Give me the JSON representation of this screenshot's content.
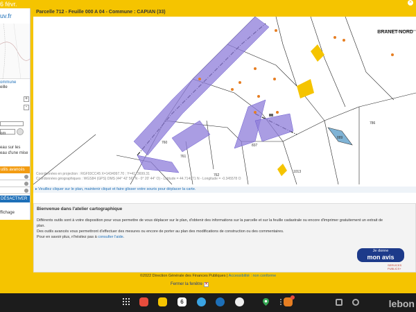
{
  "status_bar": {
    "date": "6 févr."
  },
  "sidebar": {
    "logo": "uv.fr",
    "commune_line1": "ommune",
    "commune_line2": "eille",
    "zoom_in": "+",
    "zoom_out": "-",
    "label_om": "om",
    "text_line1": "eau sur les",
    "text_line2": "eau d'une mise",
    "advanced_tools": "utils avancés",
    "deactivate": "DÉSACTIVER",
    "print": "ffichage"
  },
  "map_header": {
    "title": "Parcelle 712 - Feuille 000 A 04 - Commune : CAPIAN (33)"
  },
  "map": {
    "place_label": "BRANET-NORD",
    "parcel_labels": [
      "760",
      "761",
      "762",
      "837",
      "786",
      "1013",
      "889"
    ],
    "coords": {
      "projection_label": "Coordonnées en projection :",
      "projection_system": "RGF93CC45",
      "projection_value": "X=1434997.70 ; Y=4173699.31",
      "geo_label": "Coordonnées géographiques :",
      "geo_system": "WGS84 (GPS)",
      "geo_value": "DMS (44° 42' 56\" N - 0° 20' 44\" O) - Latitude = 44.714071 N - Longitude = -0.345578 O"
    }
  },
  "hint": "▸ Veuillez cliquer sur le plan, maintenir cliqué et faire glisser votre souris pour déplacer la carte.",
  "welcome": {
    "title": "Bienvenue dans l'atelier cartographique",
    "paragraph1": "Différents outils sont à votre disposition pour vous permettre de vous déplacer sur le plan, d'obtenir des informations sur la parcelle et sur la feuille cadastrale ou encore d'imprimer gratuitement un extrait de plan.",
    "paragraph2": "Des outils avancés vous permettront d'effectuer des mesures ou encore de porter au plan des modifications de construction ou des commentaires.",
    "paragraph3_prefix": "Pour en savoir plus, n'hésitez pas à ",
    "paragraph3_link": "consulter l'aide",
    "paragraph3_suffix": "."
  },
  "badge": {
    "line1": "Je donne",
    "line2": "mon avis",
    "services": "SERVICES PUBLICS+"
  },
  "footer": {
    "copyright": "©2022 Direction Générale des Finances Publiques",
    "separator": " | ",
    "accessibility": "Accessibilité : non conforme",
    "close_window": "Fermer la fenêtre",
    "close_x": "✕"
  },
  "taskbar": {
    "calendar_day": "6"
  },
  "watermark": "lebon",
  "colors": {
    "accent": "#f5c400",
    "parcel_highlight": "#8e7cd9",
    "building": "#f5c400",
    "brand_blue": "#1d6fb8"
  }
}
